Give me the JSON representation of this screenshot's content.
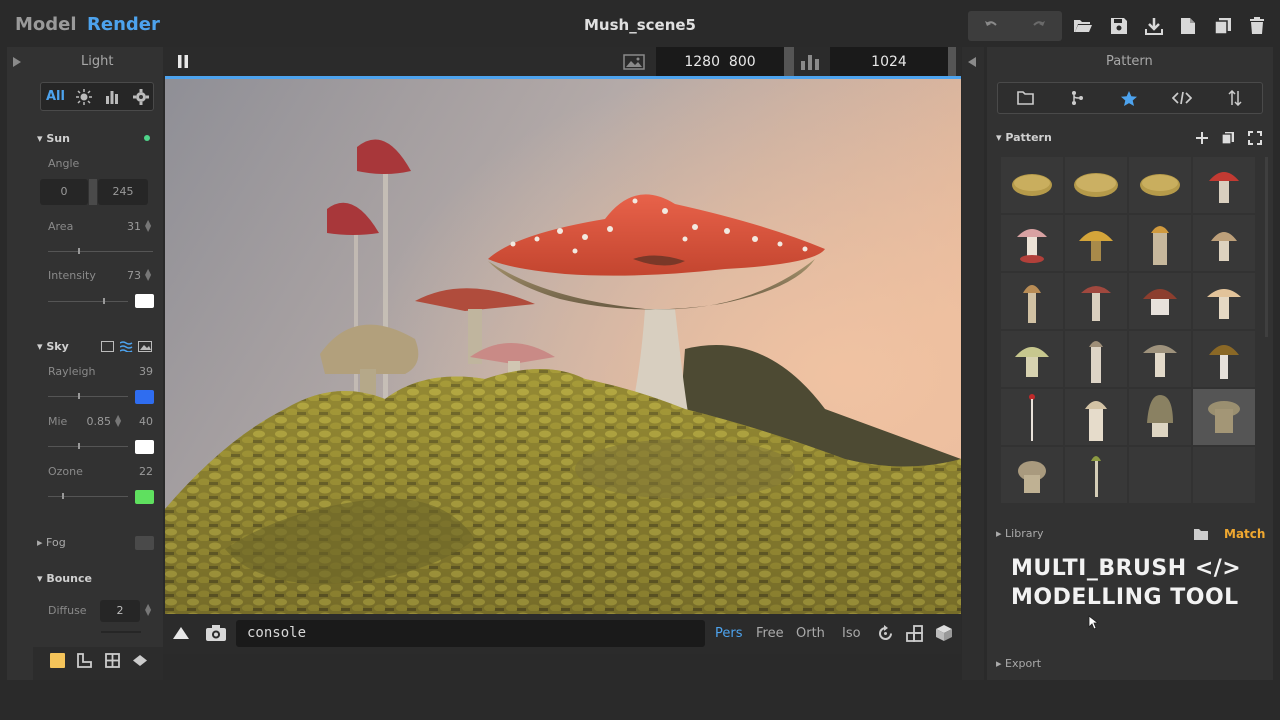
{
  "app": {
    "modes": [
      "Model",
      "Render"
    ],
    "active_mode": "Render",
    "title": "Mush_scene5"
  },
  "toolbar_icons": [
    "undo-icon",
    "redo-icon",
    "folder-open-icon",
    "save-icon",
    "download-icon",
    "new-file-icon",
    "copy-icon",
    "trash-icon"
  ],
  "left_panel": {
    "title": "Light",
    "filter_all": "All",
    "sun": {
      "label": "Sun",
      "angle_label": "Angle",
      "angle_a": "0",
      "angle_b": "245",
      "area_label": "Area",
      "area_value": "31",
      "intensity_label": "Intensity",
      "intensity_value": "73",
      "intensity_color": "#ffffff"
    },
    "sky": {
      "label": "Sky",
      "rayleigh_label": "Rayleigh",
      "rayleigh_value": "39",
      "rayleigh_color": "#2f6df0",
      "mie_label": "Mie",
      "mie_sub": "0.85",
      "mie_value": "40",
      "mie_color": "#ffffff",
      "ozone_label": "Ozone",
      "ozone_value": "22",
      "ozone_color": "#5fe05f"
    },
    "fog": {
      "label": "Fog"
    },
    "bounce": {
      "label": "Bounce",
      "diffuse_label": "Diffuse",
      "diffuse_value": "2"
    }
  },
  "viewport": {
    "res_w": "1280",
    "res_h": "800",
    "samples": "1024",
    "console": "console",
    "cameras": [
      "Pers",
      "Free",
      "Orth",
      "Iso"
    ],
    "active_camera": "Pers"
  },
  "right_panel": {
    "title": "Pattern",
    "section": "Pattern",
    "library": "Library",
    "match": "Match",
    "export": "Export",
    "overlay_line1": "MULTI_BRUSH </>",
    "overlay_line2": "MODELLING TOOL"
  },
  "colors": {
    "accent": "#4da3ee",
    "match": "#f0a830"
  }
}
